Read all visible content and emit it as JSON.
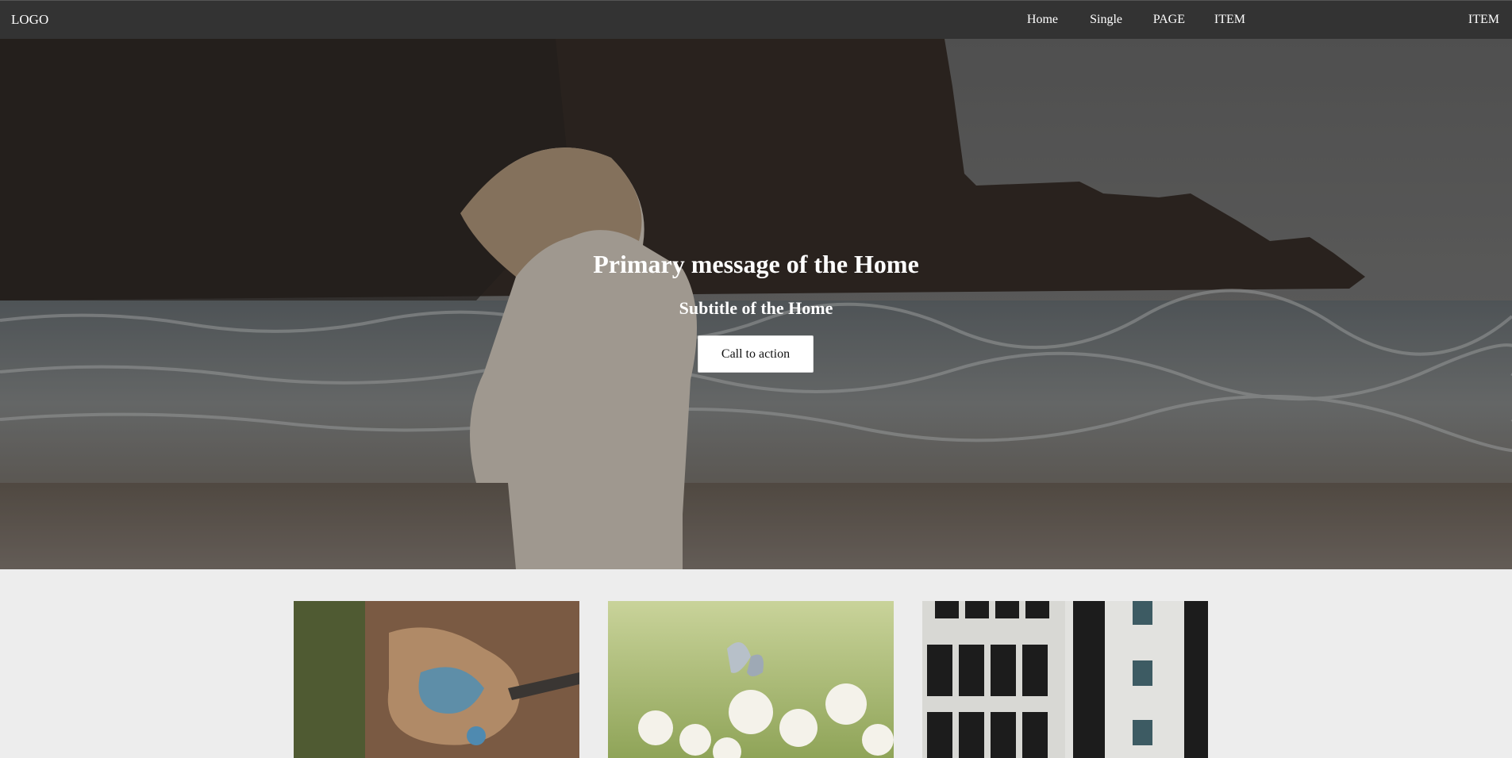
{
  "navbar": {
    "logo": "LOGO",
    "items": [
      {
        "label": "Home"
      },
      {
        "label": "Single"
      },
      {
        "label": "PAGE"
      },
      {
        "label": "ITEM"
      },
      {
        "label": "ITEM"
      }
    ]
  },
  "hero": {
    "title": "Primary message of the Home",
    "subtitle": "Subtitle of the Home",
    "cta_label": "Call to action"
  },
  "cards": [
    {
      "image": "aerial-landscape-photo"
    },
    {
      "image": "butterfly-on-flowers-photo"
    },
    {
      "image": "city-building-signs-photo"
    }
  ]
}
